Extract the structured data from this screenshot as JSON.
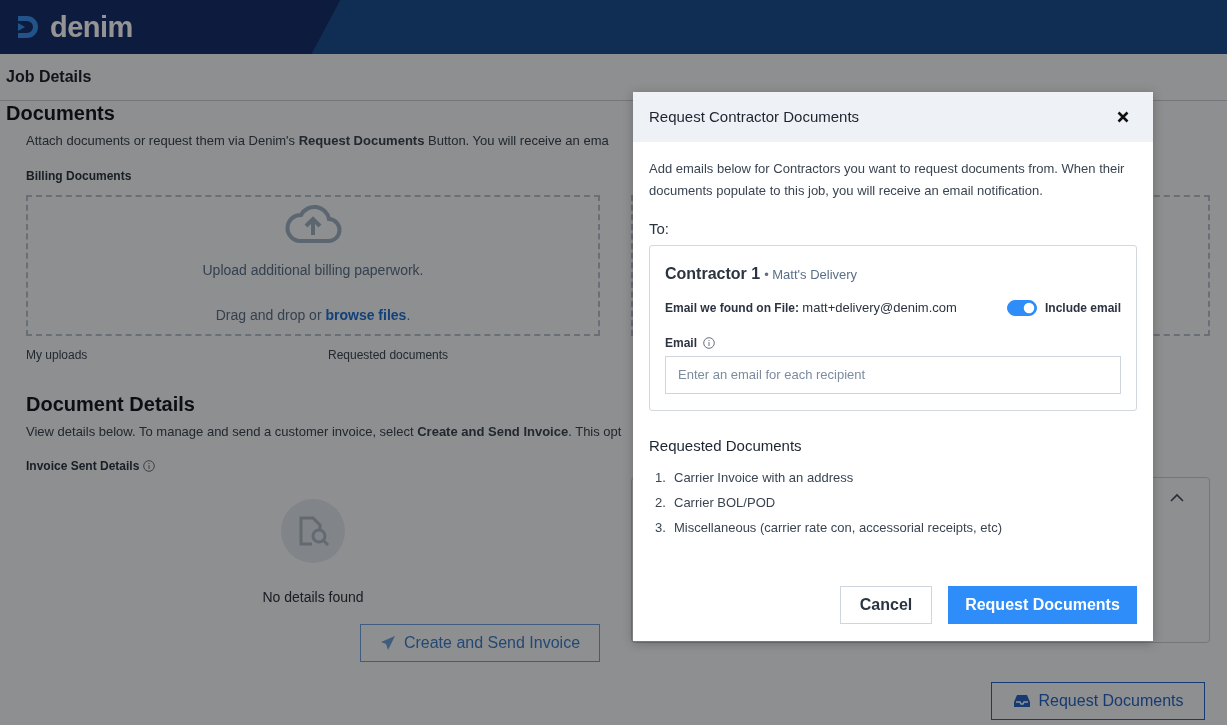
{
  "header": {
    "logo_text": "denim"
  },
  "page_title": "Job Details",
  "documents": {
    "heading": "Documents",
    "description": "Attach documents or request them via Denim's **Request Documents** Button. You will receive an ema",
    "billing": {
      "label": "Billing Documents",
      "upload_text": "Upload additional billing paperwork.",
      "drag_prefix": "Drag and drop or ",
      "browse_link": "browse files",
      "drag_suffix": "."
    },
    "tabs": [
      {
        "label": "My uploads"
      },
      {
        "label": "Requested documents"
      }
    ]
  },
  "document_details": {
    "heading": "Document Details",
    "description": "View details below. To manage and send a customer invoice, select **Create and Send Invoice**. This opt",
    "invoice_label": "Invoice Sent Details",
    "empty_text": "No details found",
    "invoice_button": {
      "label": "Create and Send Invoice",
      "disabled": true
    },
    "side_card": {
      "expanded": true
    }
  },
  "request_button": "Request Documents",
  "modal": {
    "title": "Request Contractor Documents",
    "description": "Add emails below for Contractors you want to request documents from. When their documents populate to this job, you will receive an email notification.",
    "to_label": "To:",
    "contractors": [
      {
        "name": "Contractor 1",
        "company": "• Matt's Delivery",
        "found_label": "Email we found on File:",
        "found_email": "matt+delivery@denim.com",
        "include_email": {
          "label": "Include email",
          "on": true
        },
        "email_label": "Email",
        "email_placeholder": "Enter an email for each recipient"
      }
    ],
    "requested_heading": "Requested Documents",
    "requested_items": [
      {
        "number": "1.",
        "text": "Carrier Invoice with an address"
      },
      {
        "number": "2.",
        "text": "Carrier BOL/POD"
      },
      {
        "number": "3.",
        "text": "Miscellaneous (carrier rate con, accessorial receipts, etc)"
      }
    ],
    "buttons": [
      {
        "kind": "secondary",
        "label": "Cancel"
      },
      {
        "kind": "primary",
        "label": "Request Documents"
      }
    ]
  }
}
